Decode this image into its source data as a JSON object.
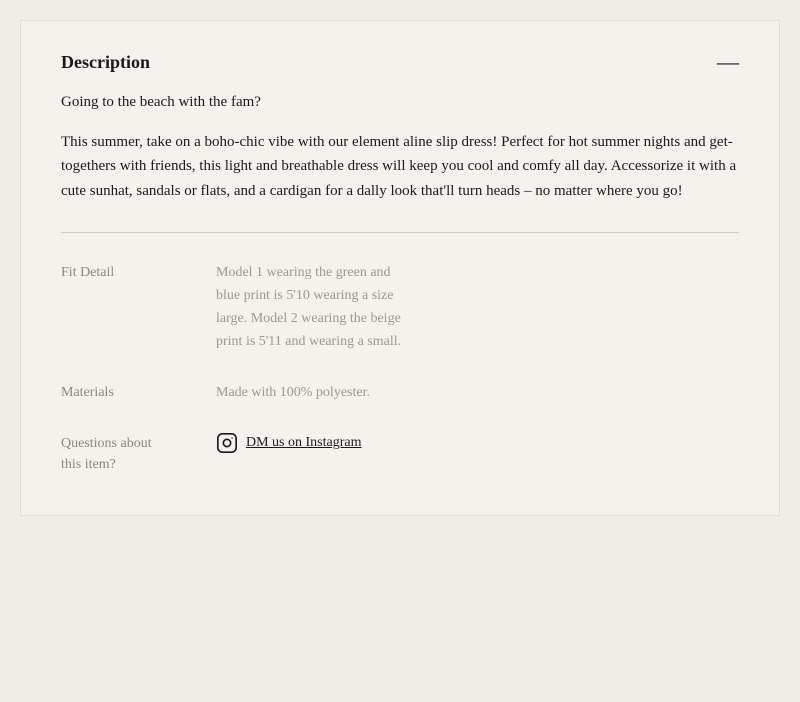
{
  "header": {
    "title": "Description",
    "collapse_icon": "—"
  },
  "description": {
    "intro": "Going to the beach with the fam?",
    "body": "This summer, take on a boho-chic vibe with our element aline slip dress! Perfect for hot summer nights and get-togethers with friends, this light and breathable dress will keep you cool and comfy all day. Accessorize it with a cute sunhat, sandals or flats, and a cardigan for a dally look that'll turn heads – no matter where you go!"
  },
  "details": {
    "fit_detail": {
      "label": "Fit Detail",
      "value": "Model 1 wearing the green and blue print is 5'10 wearing a size large. Model 2 wearing the beige print is 5'11 and wearing a small."
    },
    "materials": {
      "label": "Materials",
      "value": "Made with 100% polyester."
    },
    "questions": {
      "label_line1": "Questions about",
      "label_line2": "this item?",
      "instagram_link_text": "DM us on Instagram"
    }
  }
}
